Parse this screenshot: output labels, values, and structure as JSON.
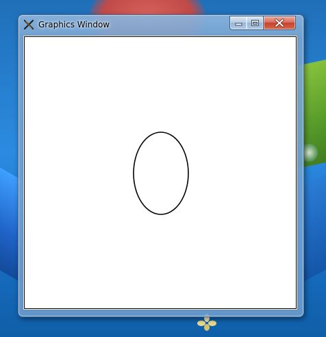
{
  "window": {
    "title": "Graphics Window",
    "icon": "app-x-icon"
  },
  "title_buttons": {
    "minimize_icon": "minimize-icon",
    "maximize_icon": "maximize-icon",
    "close_icon": "close-icon"
  },
  "canvas": {
    "background": "#ffffff",
    "shapes": [
      {
        "type": "ellipse",
        "stroke": "#000000",
        "fill": "none"
      }
    ]
  },
  "colors": {
    "close_button": "#c7422f",
    "title_bar": "#78a5d2",
    "desktop": "#2c8be0"
  }
}
